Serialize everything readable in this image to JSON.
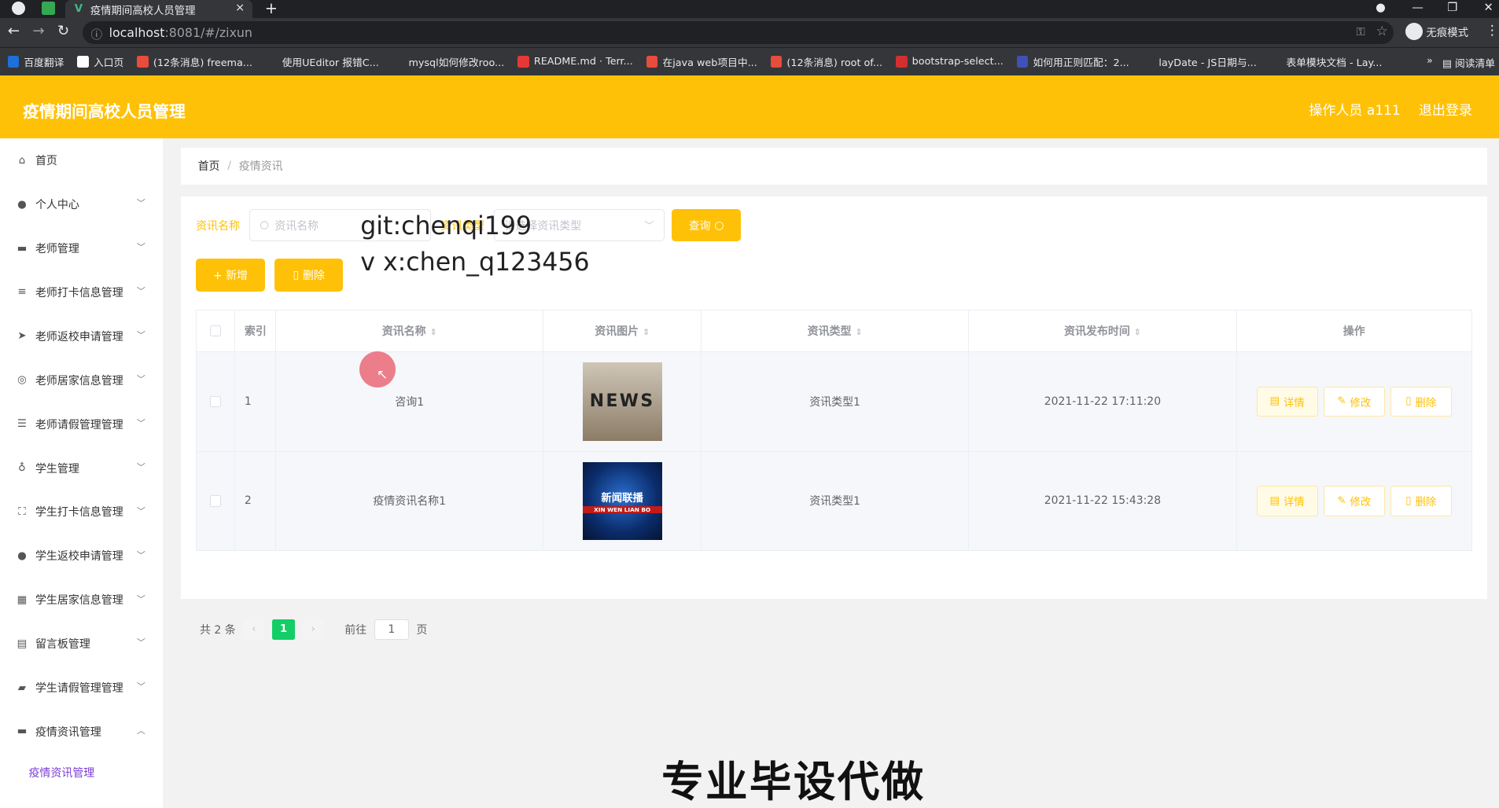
{
  "browser": {
    "tab_title": "疫情期间高校人员管理",
    "tab_close": "×",
    "new_tab": "+",
    "url_host": "localhost",
    "url_path": ":8081/#/zixun",
    "incognito": "无痕模式",
    "bookmarks": [
      "百度翻译",
      "入口页",
      "(12条消息) freema...",
      "使用UEditor 报错C...",
      "mysql如何修改roo...",
      "README.md · Terr...",
      "在java web项目中...",
      "(12条消息) root of...",
      "bootstrap-select...",
      "如何用正则匹配：2...",
      "layDate - JS日期与...",
      "表单模块文档 - Lay..."
    ],
    "bookmark_colors": [
      "#1e6fd9",
      "#ffffff",
      "#e74c3c",
      "#35363a",
      "#35363a",
      "#e53935",
      "#e74c3c",
      "#e74c3c",
      "#d32f2f",
      "#3f51b5",
      "#35363a",
      "#35363a"
    ],
    "reading_list": "阅读清单"
  },
  "header": {
    "title": "疫情期间高校人员管理",
    "operator": "操作人员 a111",
    "logout": "退出登录"
  },
  "sidebar": {
    "items": [
      {
        "label": "首页",
        "icon": "home-icon",
        "glyph": "⌂",
        "chevron": ""
      },
      {
        "label": "个人中心",
        "icon": "user-icon",
        "glyph": "●",
        "chevron": "﹀"
      },
      {
        "label": "老师管理",
        "icon": "monitor-icon",
        "glyph": "▬",
        "chevron": "﹀"
      },
      {
        "label": "老师打卡信息管理",
        "icon": "sliders-icon",
        "glyph": "≡",
        "chevron": "﹀"
      },
      {
        "label": "老师返校申请管理",
        "icon": "send-icon",
        "glyph": "➤",
        "chevron": "﹀"
      },
      {
        "label": "老师居家信息管理",
        "icon": "compass-icon",
        "glyph": "◎",
        "chevron": "﹀"
      },
      {
        "label": "老师请假管理管理",
        "icon": "list-icon",
        "glyph": "☰",
        "chevron": "﹀"
      },
      {
        "label": "学生管理",
        "icon": "microphone-icon",
        "glyph": "♁",
        "chevron": "﹀"
      },
      {
        "label": "学生打卡信息管理",
        "icon": "fullscreen-icon",
        "glyph": "⛶",
        "chevron": "﹀"
      },
      {
        "label": "学生返校申请管理",
        "icon": "user-icon",
        "glyph": "●",
        "chevron": "﹀"
      },
      {
        "label": "学生居家信息管理",
        "icon": "grid-icon",
        "glyph": "▦",
        "chevron": "﹀"
      },
      {
        "label": "留言板管理",
        "icon": "message-icon",
        "glyph": "▤",
        "chevron": "﹀"
      },
      {
        "label": "学生请假管理管理",
        "icon": "suitcase-icon",
        "glyph": "▰",
        "chevron": "﹀"
      },
      {
        "label": "疫情资讯管理",
        "icon": "monitor-icon",
        "glyph": "▬",
        "chevron": "︿"
      }
    ],
    "submenu": "疫情资讯管理"
  },
  "breadcrumb": {
    "home": "首页",
    "sep": "/",
    "current": "疫情资讯"
  },
  "search": {
    "name_label": "资讯名称",
    "name_placeholder": "资讯名称",
    "type_label": "资讯类型",
    "type_placeholder": "请选择资讯类型",
    "query_button": "查询"
  },
  "actions": {
    "add": "+ 新增",
    "delete": "删除"
  },
  "table": {
    "headers": [
      "索引",
      "资讯名称",
      "资讯图片",
      "资讯类型",
      "资讯发布时间",
      "操作"
    ],
    "rows": [
      {
        "index": "1",
        "name": "咨询1",
        "image": "NEWS",
        "type": "资讯类型1",
        "time": "2021-11-22 17:11:20"
      },
      {
        "index": "2",
        "name": "疫情资讯名称1",
        "image": "新闻联播",
        "image_sub": "XIN WEN LIAN BO",
        "type": "资讯类型1",
        "time": "2021-11-22 15:43:28"
      }
    ],
    "op_detail": "详情",
    "op_edit": "修改",
    "op_delete": "删除"
  },
  "pagination": {
    "total": "共 2 条",
    "page": "1",
    "goto_label": "前往",
    "goto_value": "1",
    "page_unit": "页"
  },
  "overlay": {
    "git": "git:chenqi199",
    "vx": "v x:chen_q123456",
    "banner": "专业毕设代做"
  },
  "colors": {
    "accent": "#ffc107",
    "pager_active": "#13ce66",
    "submenu": "#7b3ed6"
  }
}
